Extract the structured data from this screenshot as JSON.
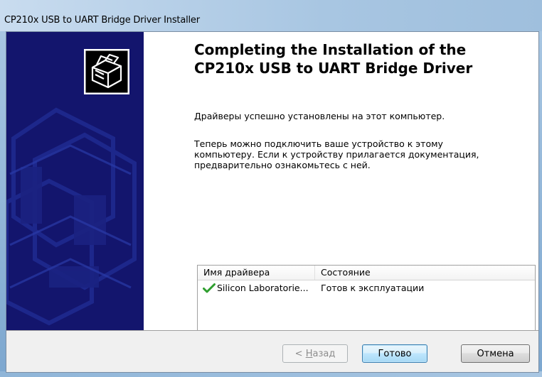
{
  "window": {
    "title": "CP210x USB to UART Bridge Driver Installer"
  },
  "main": {
    "heading_line1": "Completing the Installation of the",
    "heading_line2": "CP210x USB to UART Bridge Driver",
    "success_text": "Драйверы успешно установлены на этот компьютер.",
    "info_line1": "Теперь можно подключить ваше устройство к этому",
    "info_line2": "компьютеру. Если к устройству прилагается документация,",
    "info_line3": "предварительно ознакомьтесь с ней."
  },
  "driver_list": {
    "columns": [
      "Имя драйвера",
      "Состояние"
    ],
    "rows": [
      {
        "name": "Silicon Laboratorie...",
        "status": "Готов к эксплуатации",
        "icon": "check-icon"
      }
    ]
  },
  "buttons": {
    "back_label_prefix": "< ",
    "back_label_mnemonic": "Н",
    "back_label_rest": "азад",
    "finish_label": "Готово",
    "cancel_label": "Отмена"
  },
  "colors": {
    "banner": "#13156d",
    "check": "#2e9e2e",
    "finish_border": "#3c7fb1"
  }
}
